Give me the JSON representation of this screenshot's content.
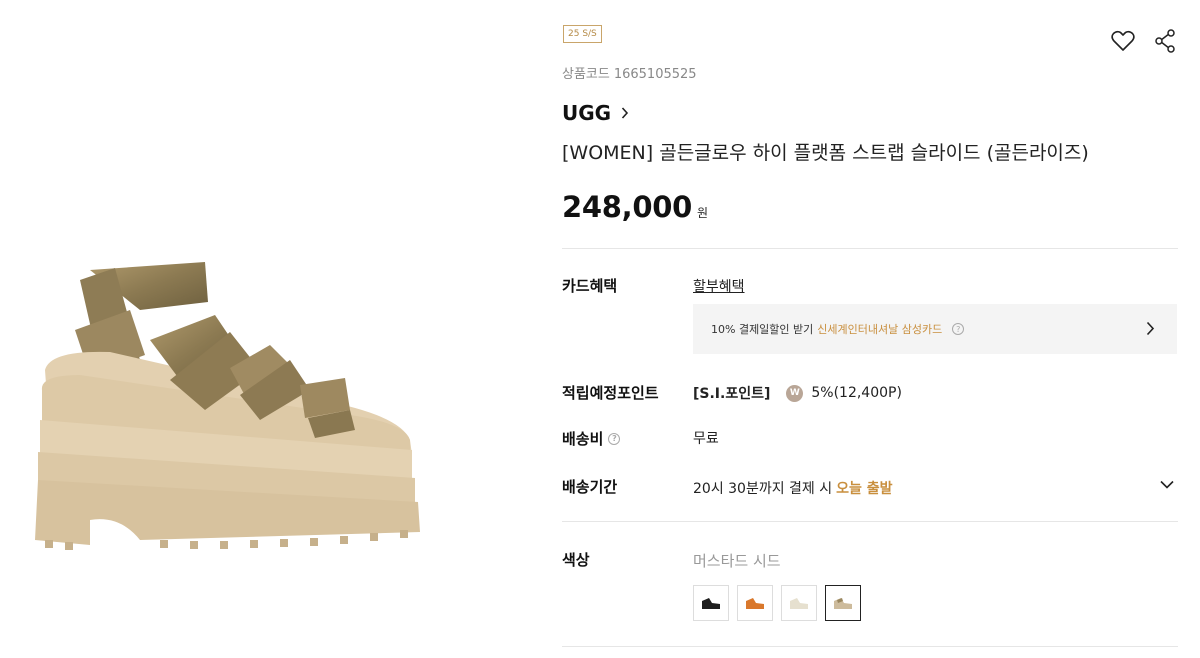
{
  "product": {
    "season_badge": "25 S/S",
    "code_label": "상품코드",
    "code_value": "1665105525",
    "brand": "UGG",
    "title": "[WOMEN] 골든글로우 하이 플랫폼 스트랩 슬라이드 (골든라이즈)",
    "price": "248,000",
    "price_unit": "원",
    "image_icon": "platform-strap-sandal-image"
  },
  "actions": {
    "wishlist_icon": "heart-icon",
    "share_icon": "share-icon"
  },
  "card_benefit": {
    "label": "카드혜택",
    "link": "할부혜택",
    "promo_text": "10% 결제일할인 받기",
    "promo_accent": "신세계인터내셔날 삼성카드"
  },
  "points": {
    "label": "적립예정포인트",
    "prefix": "[S.I.포인트]",
    "icon_letter": "W",
    "value": "5%(12,400P)"
  },
  "shipping_fee": {
    "label": "배송비",
    "value": "무료"
  },
  "shipping_period": {
    "label": "배송기간",
    "text": "20시 30분까지 결제 시",
    "accent": "오늘 출발"
  },
  "color": {
    "label": "색상",
    "selected_name": "머스타드 시드",
    "swatches": [
      {
        "name": "black",
        "color": "#1e1e1e"
      },
      {
        "name": "orange",
        "color": "#d9782c"
      },
      {
        "name": "cream",
        "color": "#e6e0cf"
      },
      {
        "name": "mustard-seed",
        "color": "#cdbb9c",
        "selected": true
      }
    ]
  },
  "colors": {
    "accent": "#c98f3e",
    "badge": "#b58a46",
    "card_bg": "#f4f4f4"
  }
}
